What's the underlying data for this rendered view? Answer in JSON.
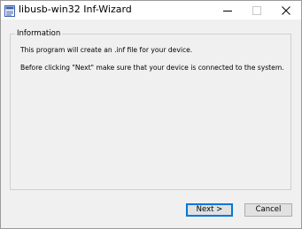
{
  "window": {
    "title": "libusb-win32 Inf-Wizard",
    "icon": "inf-document-icon",
    "controls": [
      "minimize",
      "maximize",
      "close"
    ]
  },
  "group": {
    "label": "Information",
    "lines": [
      "This program will create an .inf file for your device.",
      "Before clicking \"Next\" make sure that your device is connected to the system."
    ]
  },
  "buttons": {
    "next": "Next >",
    "cancel": "Cancel"
  },
  "colors": {
    "dialog_bg": "#f0f0f0",
    "titlebar_bg": "#ffffff",
    "default_button_border": "#0078d7"
  }
}
